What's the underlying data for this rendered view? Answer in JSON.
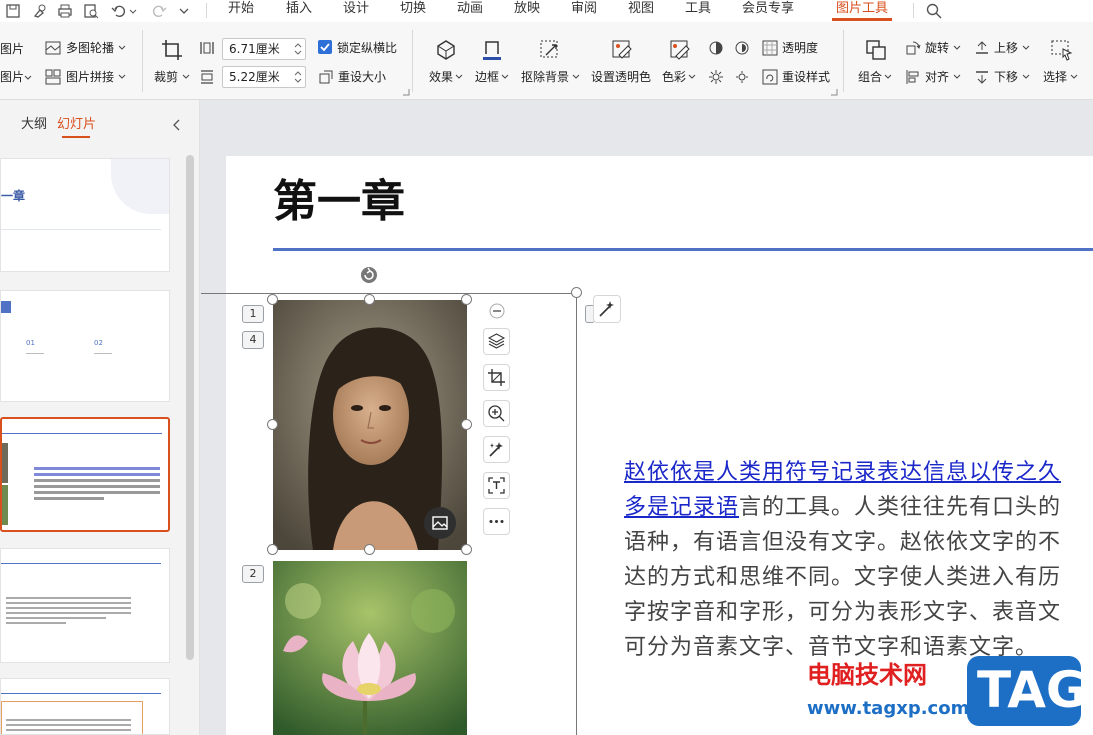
{
  "menubar": {
    "items": [
      "开始",
      "插入",
      "设计",
      "切换",
      "动画",
      "放映",
      "审阅",
      "视图",
      "工具",
      "会员专享"
    ],
    "active": "图片工具"
  },
  "ribbon": {
    "clip_top": "图片",
    "clip_bottom": "图片",
    "multi_outline": "多图轮播",
    "stitch": "图片拼接",
    "crop": "裁剪",
    "width_value": "6.71厘米",
    "height_value": "5.22厘米",
    "lock_ratio": "锁定纵横比",
    "reset_size": "重设大小",
    "effects": "效果",
    "border": "边框",
    "remove_bg": "抠除背景",
    "set_transparent": "设置透明色",
    "color": "色彩",
    "transparency": "透明度",
    "reset_style": "重设样式",
    "group": "组合",
    "rotate": "旋转",
    "align": "对齐",
    "bring_up": "上移",
    "send_down": "下移",
    "select": "选择"
  },
  "left_panel": {
    "tab_outline": "大纲",
    "tab_slides": "幻灯片",
    "thumb1_title": "一章",
    "thumb2_labels": [
      "01",
      "02"
    ]
  },
  "slide": {
    "title": "第一章",
    "badges": [
      "1",
      "4",
      "2"
    ],
    "paragraph": {
      "line1_link": "赵依依是人类用符号记录表达信息以传之久",
      "line2_link": "多是记录语",
      "line2_rest": "言的工具。人类往往先有口头的",
      "line3": "语种，有语言但没有文字。赵依依文字的不",
      "line4": "达的方式和思维不同。文字使人类进入有历",
      "line5": "字按字音和字形，可分为表形文字、表音文",
      "line6": "可分为音素文字、音节文字和语素文字。"
    }
  },
  "watermark": {
    "site_name": "电脑技术网",
    "url": "www.tagxp.com",
    "logo": "TAG"
  },
  "colors": {
    "accent": "#d9501f",
    "title_rule": "#4f72c4",
    "link": "#1a27c9",
    "watermark_red": "#e02020",
    "watermark_blue": "#1d6fc5"
  }
}
